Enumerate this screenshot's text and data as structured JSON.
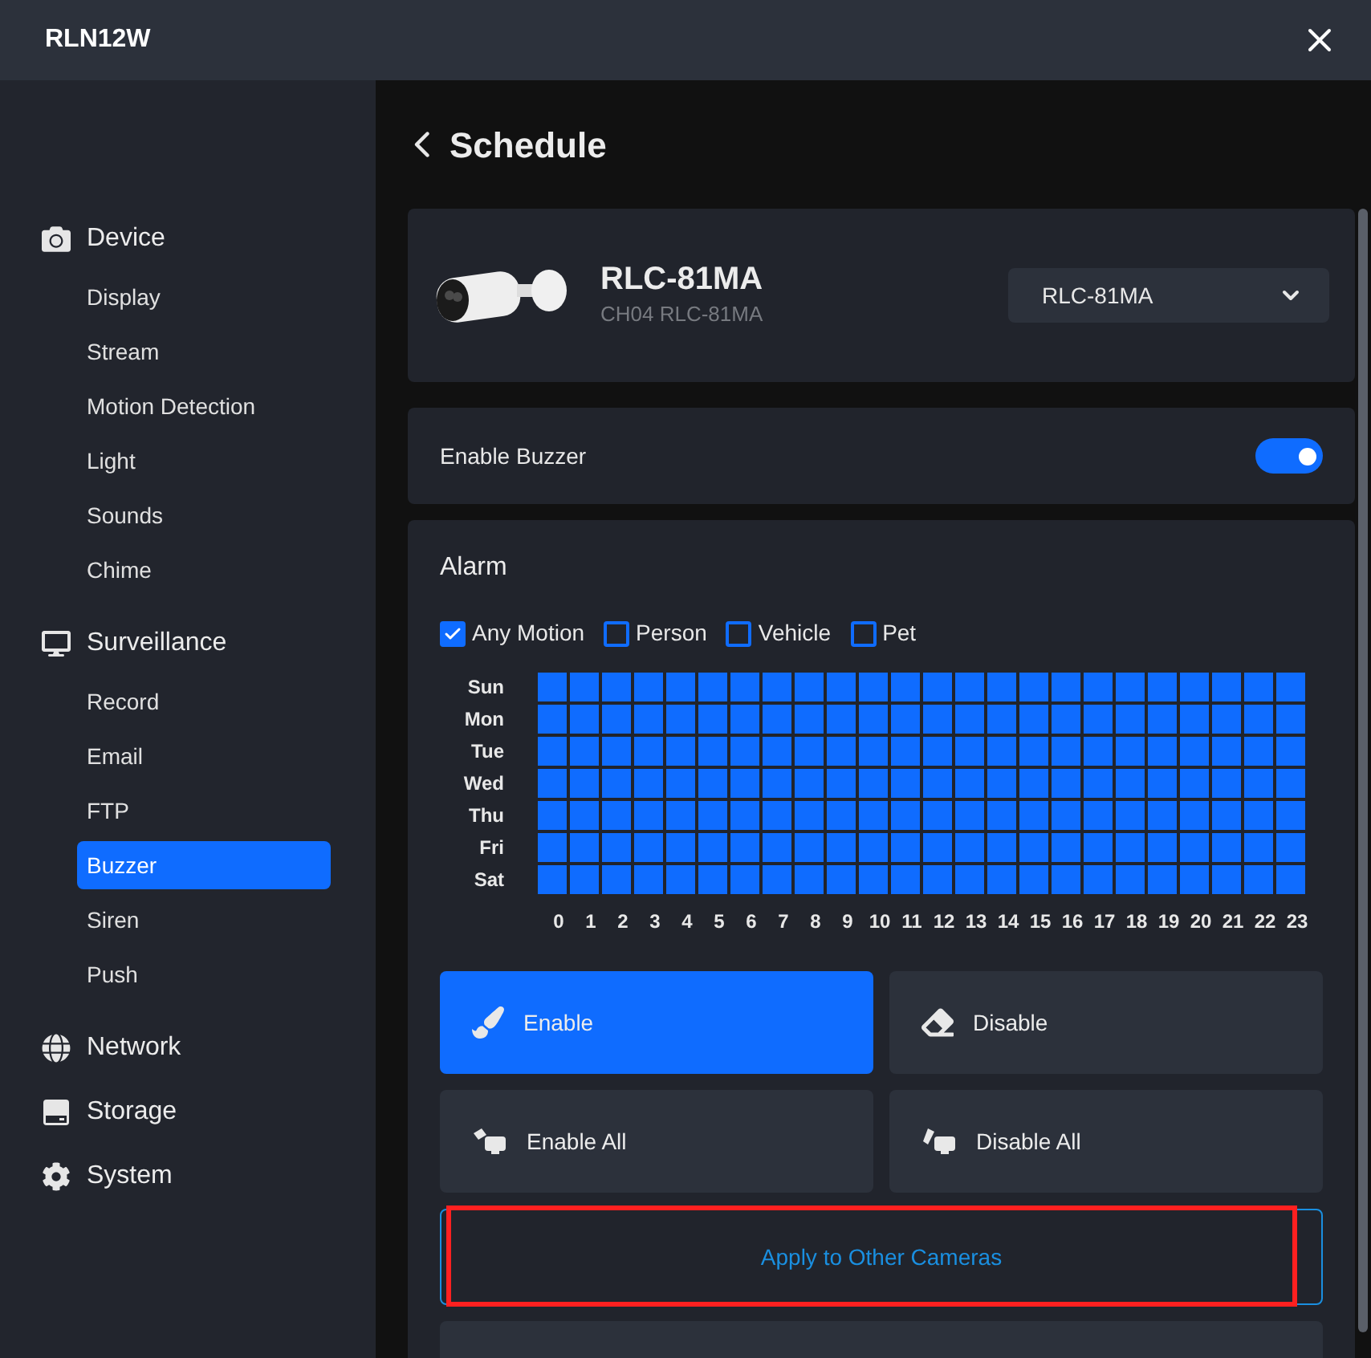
{
  "window": {
    "title": "RLN12W"
  },
  "sidebar": {
    "groups": [
      {
        "label": "Device",
        "items": [
          {
            "label": "Display",
            "selected": false
          },
          {
            "label": "Stream",
            "selected": false
          },
          {
            "label": "Motion Detection",
            "selected": false
          },
          {
            "label": "Light",
            "selected": false
          },
          {
            "label": "Sounds",
            "selected": false
          },
          {
            "label": "Chime",
            "selected": false
          }
        ]
      },
      {
        "label": "Surveillance",
        "items": [
          {
            "label": "Record",
            "selected": false
          },
          {
            "label": "Email",
            "selected": false
          },
          {
            "label": "FTP",
            "selected": false
          },
          {
            "label": "Buzzer",
            "selected": true
          },
          {
            "label": "Siren",
            "selected": false
          },
          {
            "label": "Push",
            "selected": false
          }
        ]
      },
      {
        "label": "Network"
      },
      {
        "label": "Storage"
      },
      {
        "label": "System"
      }
    ]
  },
  "page": {
    "title": "Schedule"
  },
  "camera": {
    "name": "RLC-81MA",
    "channel": "CH04 RLC-81MA",
    "select_value": "RLC-81MA"
  },
  "buzzer": {
    "label": "Enable Buzzer",
    "on": true
  },
  "alarm": {
    "title": "Alarm",
    "filters": [
      {
        "label": "Any Motion",
        "checked": true
      },
      {
        "label": "Person",
        "checked": false
      },
      {
        "label": "Vehicle",
        "checked": false
      },
      {
        "label": "Pet",
        "checked": false
      }
    ],
    "hours": [
      "0",
      "1",
      "2",
      "3",
      "4",
      "5",
      "6",
      "7",
      "8",
      "9",
      "10",
      "11",
      "12",
      "13",
      "14",
      "15",
      "16",
      "17",
      "18",
      "19",
      "20",
      "21",
      "22",
      "23"
    ],
    "schedule": [
      {
        "day": "Sun",
        "slots": [
          true,
          true,
          true,
          true,
          true,
          true,
          true,
          true,
          true,
          true,
          true,
          true,
          true,
          true,
          true,
          true,
          true,
          true,
          true,
          true,
          true,
          true,
          true,
          true
        ]
      },
      {
        "day": "Mon",
        "slots": [
          true,
          true,
          true,
          true,
          true,
          true,
          true,
          true,
          true,
          true,
          true,
          true,
          true,
          true,
          true,
          true,
          true,
          true,
          true,
          true,
          true,
          true,
          true,
          true
        ]
      },
      {
        "day": "Tue",
        "slots": [
          true,
          true,
          true,
          true,
          true,
          true,
          true,
          true,
          true,
          true,
          true,
          true,
          true,
          true,
          true,
          true,
          true,
          true,
          true,
          true,
          true,
          true,
          true,
          true
        ]
      },
      {
        "day": "Wed",
        "slots": [
          true,
          true,
          true,
          true,
          true,
          true,
          true,
          true,
          true,
          true,
          true,
          true,
          true,
          true,
          true,
          true,
          true,
          true,
          true,
          true,
          true,
          true,
          true,
          true
        ]
      },
      {
        "day": "Thu",
        "slots": [
          true,
          true,
          true,
          true,
          true,
          true,
          true,
          true,
          true,
          true,
          true,
          true,
          true,
          true,
          true,
          true,
          true,
          true,
          true,
          true,
          true,
          true,
          true,
          true
        ]
      },
      {
        "day": "Fri",
        "slots": [
          true,
          true,
          true,
          true,
          true,
          true,
          true,
          true,
          true,
          true,
          true,
          true,
          true,
          true,
          true,
          true,
          true,
          true,
          true,
          true,
          true,
          true,
          true,
          true
        ]
      },
      {
        "day": "Sat",
        "slots": [
          true,
          true,
          true,
          true,
          true,
          true,
          true,
          true,
          true,
          true,
          true,
          true,
          true,
          true,
          true,
          true,
          true,
          true,
          true,
          true,
          true,
          true,
          true,
          true
        ]
      }
    ],
    "tools": [
      {
        "kind": "enable",
        "label": "Enable",
        "selected": true
      },
      {
        "kind": "disable",
        "label": "Disable",
        "selected": false
      },
      {
        "kind": "enable_all",
        "label": "Enable All",
        "selected": false
      },
      {
        "kind": "disable_all",
        "label": "Disable All",
        "selected": false
      }
    ],
    "apply": {
      "label": "Apply to Other Cameras",
      "highlighted": true
    }
  }
}
